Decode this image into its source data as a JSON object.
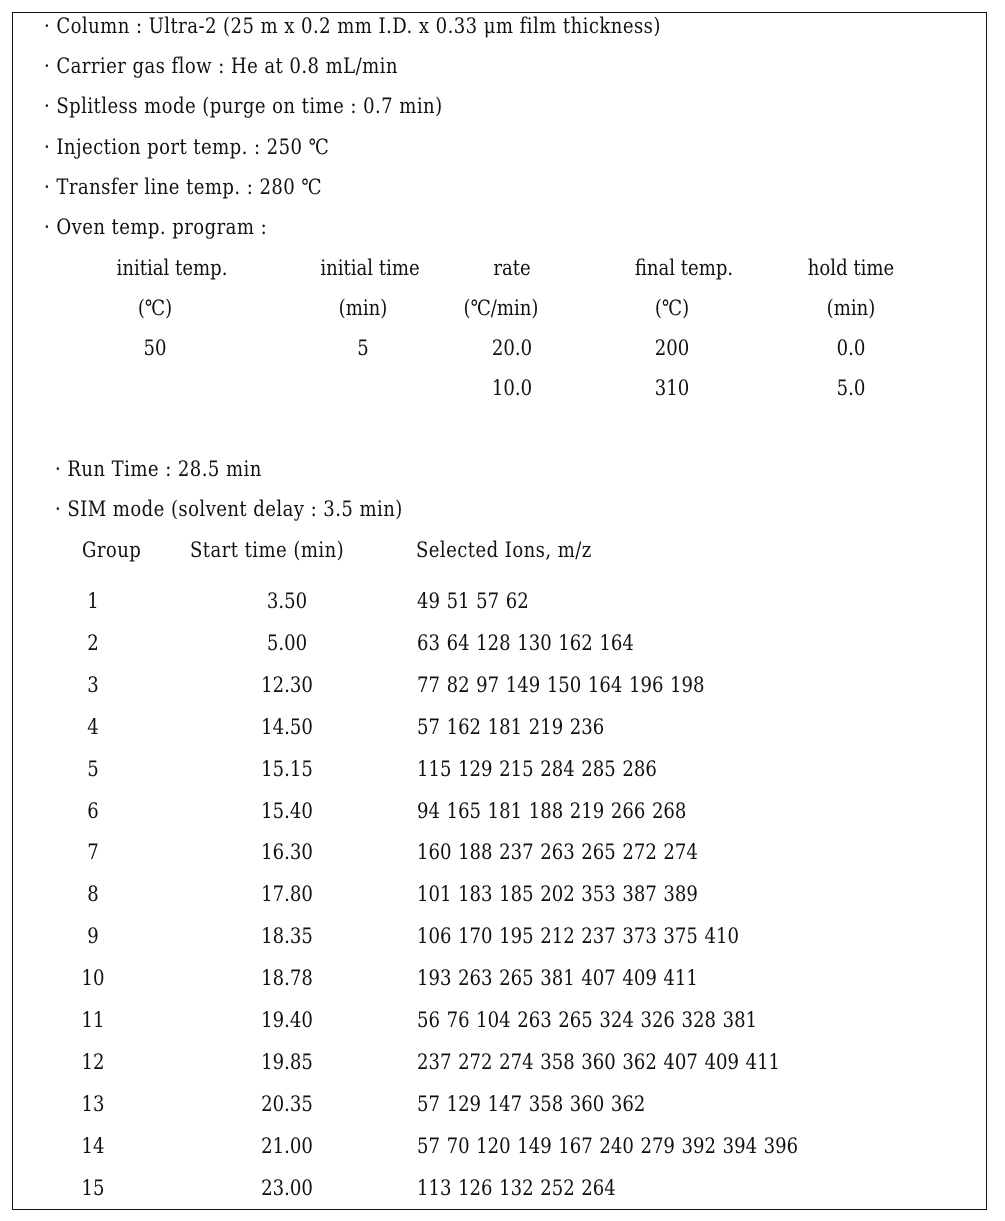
{
  "conditions": [
    "· Column : Ultra-2 (25 m x 0.2 mm I.D. x 0.33 μm film thickness)",
    "· Carrier gas flow : He at 0.8 mL/min",
    "· Splitless mode (purge on time : 0.7 min)",
    "· Injection port temp. : 250 ℃",
    "· Transfer line temp. : 280 ℃",
    "· Oven temp. program :"
  ],
  "oven_program": {
    "headers": [
      "initial temp.",
      "initial time",
      "rate",
      "final temp.",
      "hold time"
    ],
    "units": [
      "(℃)",
      "(min)",
      "(℃/min)",
      "(℃)",
      "(min)"
    ],
    "rows": [
      [
        "50",
        "5",
        "20.0",
        "200",
        "0.0"
      ],
      [
        "",
        "",
        "10.0",
        "310",
        "5.0"
      ]
    ]
  },
  "run_time": "· Run Time : 28.5 min",
  "sim_mode": "· SIM mode (solvent delay : 3.5 min)",
  "sim_table": {
    "headers": [
      "Group",
      "Start time (min)",
      "Selected Ions, m/z"
    ],
    "rows": [
      [
        "1",
        "3.50",
        "49 51 57 62"
      ],
      [
        "2",
        "5.00",
        "63 64 128 130 162 164"
      ],
      [
        "3",
        "12.30",
        "77 82 97 149 150 164 196 198"
      ],
      [
        "4",
        "14.50",
        "57 162 181 219 236"
      ],
      [
        "5",
        "15.15",
        "115 129 215 284 285 286"
      ],
      [
        "6",
        "15.40",
        "94 165 181 188 219 266 268"
      ],
      [
        "7",
        "16.30",
        "160 188 237 263 265 272 274"
      ],
      [
        "8",
        "17.80",
        "101 183 185 202 353 387 389"
      ],
      [
        "9",
        "18.35",
        "106 170 195 212 237 373 375 410"
      ],
      [
        "10",
        "18.78",
        "193 263 265 381 407 409 411"
      ],
      [
        "11",
        "19.40",
        "56 76 104 263 265 324 326 328 381"
      ],
      [
        "12",
        "19.85",
        "237 272 274 358 360 362 407 409 411"
      ],
      [
        "13",
        "20.35",
        "57 129 147 358 360 362"
      ],
      [
        "14",
        "21.00",
        "57 70 120 149 167 240 279 392 394 396"
      ],
      [
        "15",
        "23.00",
        "113 126 132 252 264"
      ]
    ]
  }
}
